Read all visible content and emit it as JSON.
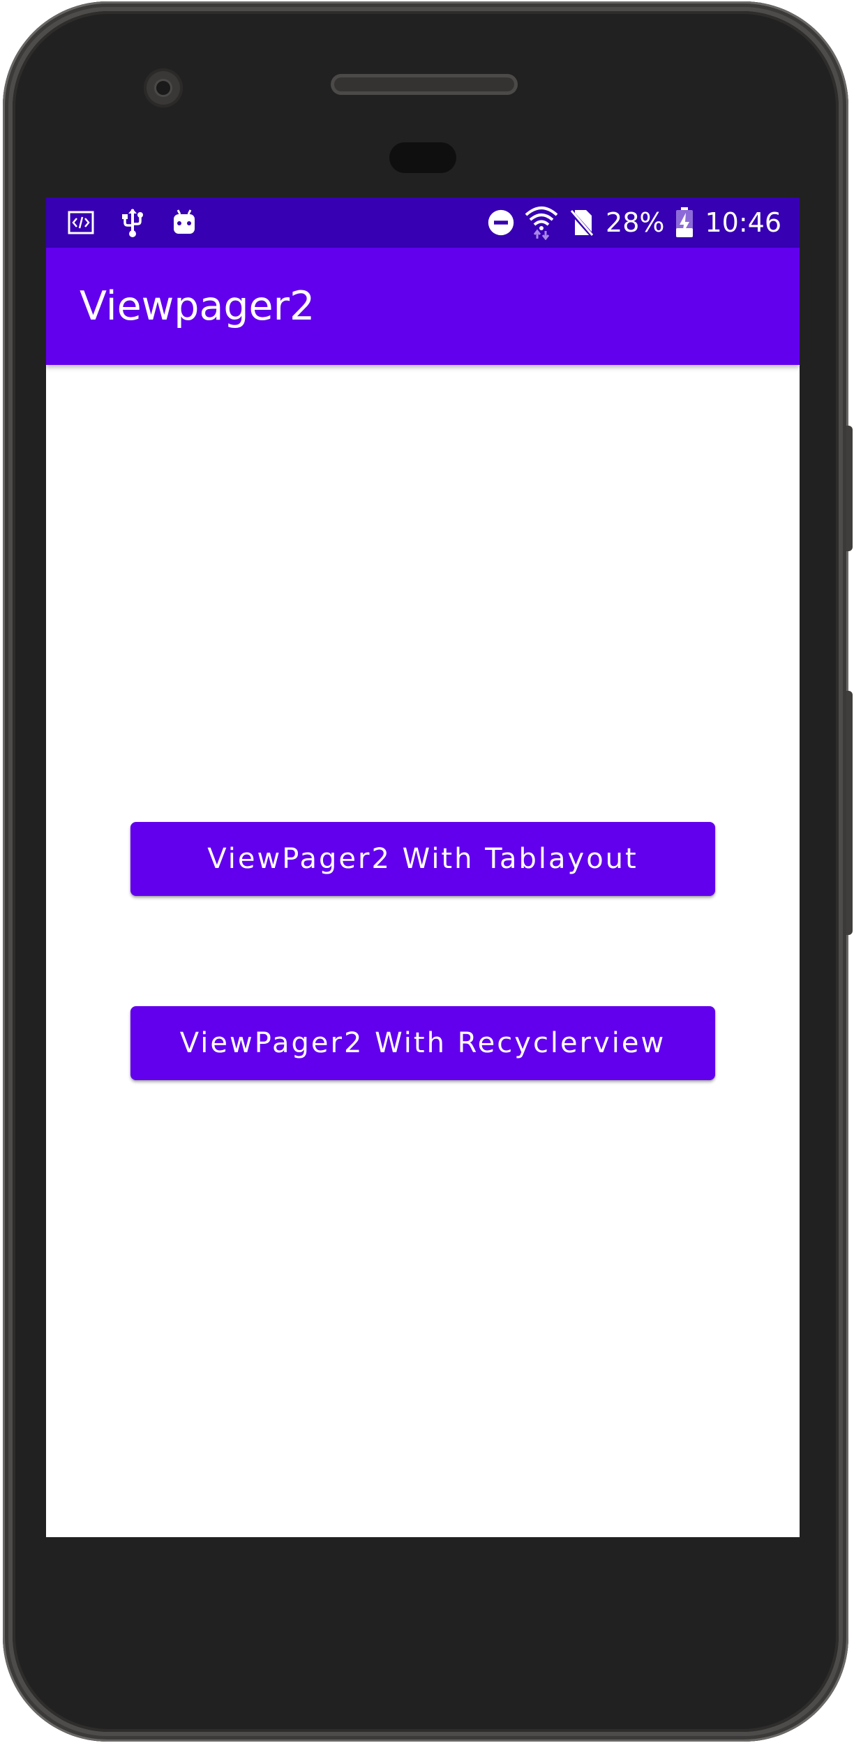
{
  "status_bar": {
    "icons_left": [
      "code-icon",
      "usb-icon",
      "android-icon"
    ],
    "icons_right": [
      "do-not-disturb-icon",
      "wifi-icon",
      "no-sim-icon"
    ],
    "battery_percent": "28%",
    "battery_icon": "battery-charging-icon",
    "time": "10:46",
    "background": "#3700b3"
  },
  "app_bar": {
    "title": "Viewpager2",
    "background": "#6200ee"
  },
  "main": {
    "buttons": [
      {
        "label": "ViewPager2 With Tablayout"
      },
      {
        "label": "ViewPager2 With Recyclerview"
      }
    ],
    "button_color": "#6200ee"
  }
}
